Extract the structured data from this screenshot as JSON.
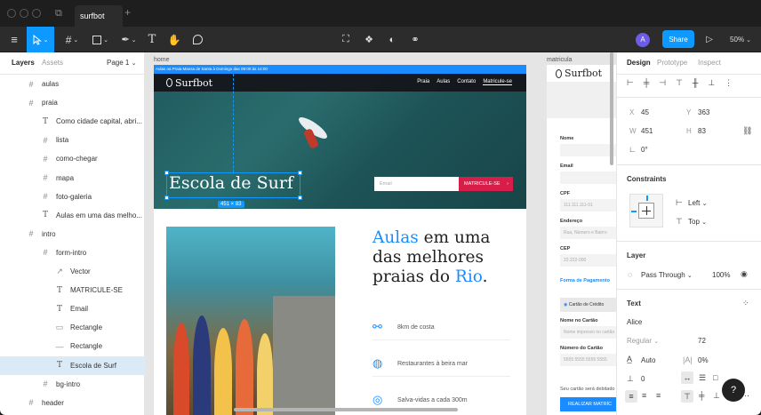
{
  "titlebar": {
    "tab_label": "surfbot",
    "new_tab": "+"
  },
  "toolbar": {
    "share_label": "Share",
    "zoom_label": "50%",
    "avatar_initial": "A"
  },
  "left": {
    "tab_layers": "Layers",
    "tab_assets": "Assets",
    "page_label": "Page 1",
    "layers": [
      {
        "label": "aulas",
        "type": "frame",
        "indent": 0
      },
      {
        "label": "praia",
        "type": "frame",
        "indent": 0
      },
      {
        "label": "Como cidade capital, abri...",
        "type": "text",
        "indent": 1
      },
      {
        "label": "lista",
        "type": "frame",
        "indent": 1
      },
      {
        "label": "como-chegar",
        "type": "frame",
        "indent": 1
      },
      {
        "label": "mapa",
        "type": "frame",
        "indent": 1
      },
      {
        "label": "foto-galeria",
        "type": "frame",
        "indent": 1
      },
      {
        "label": "Aulas em uma das melho...",
        "type": "text",
        "indent": 1
      },
      {
        "label": "intro",
        "type": "frame",
        "indent": 0
      },
      {
        "label": "form-intro",
        "type": "frame",
        "indent": 1
      },
      {
        "label": "Vector",
        "type": "vector",
        "indent": 2
      },
      {
        "label": "MATRICULE-SE",
        "type": "text",
        "indent": 2
      },
      {
        "label": "Email",
        "type": "text",
        "indent": 2
      },
      {
        "label": "Rectangle",
        "type": "rect",
        "indent": 2
      },
      {
        "label": "Rectangle",
        "type": "line",
        "indent": 2
      },
      {
        "label": "Escola de Surf",
        "type": "text",
        "indent": 2,
        "selected": true
      },
      {
        "label": "bg-intro",
        "type": "frame",
        "indent": 1
      },
      {
        "label": "header",
        "type": "frame",
        "indent": 0
      }
    ]
  },
  "canvas": {
    "frame_home_label": "home",
    "frame_matricula_label": "matricula",
    "topbar_text": "Aulas na Praia Mansa de Santa à Domingo das 09:00 às 14:00",
    "logo": "Surfbot",
    "nav": [
      "Praia",
      "Aulas",
      "Contato",
      "Matricule-se"
    ],
    "hero_title": "Escola de Surf",
    "dim_badge": "451 × 83",
    "email_placeholder": "Email",
    "cta": "MATRICULE-SE",
    "section_h1": "Aulas",
    "section_h2": " em uma das melhores praias do ",
    "section_h3": "Rio",
    "section_h4": ".",
    "features": [
      "8km de costa",
      "Restaurantes à beira mar",
      "Salva-vidas a cada 300m"
    ],
    "form": {
      "logo": "Surfbot",
      "name_label": "Nome",
      "email_label": "Email",
      "cpf_label": "CPF",
      "cpf_placeholder": "111.111.111-01",
      "address_label": "Endereço",
      "address_placeholder": "Rua, Número e Bairro",
      "cep_label": "CEP",
      "cep_placeholder": "22.222-000",
      "payment_label": "Forma de Pagamento",
      "card_option": "Cartão de Crédito",
      "card_name_label": "Nome no Cartão",
      "card_name_placeholder": "Nome impresso no cartão",
      "card_number_label": "Número do Cartão",
      "card_number_placeholder": "5555 5555 5555 5555",
      "debit_note": "Seu cartão será debitado",
      "submit": "REALIZAR MATRÍC"
    }
  },
  "right": {
    "tab_design": "Design",
    "tab_prototype": "Prototype",
    "tab_inspect": "Inspect",
    "x_label": "X",
    "x": "45",
    "y_label": "Y",
    "y": "363",
    "w_label": "W",
    "w": "451",
    "h_label": "H",
    "h": "83",
    "rot": "0°",
    "constraints_title": "Constraints",
    "c_h": "Left",
    "c_v": "Top",
    "layer_title": "Layer",
    "blend": "Pass Through",
    "opacity": "100%",
    "text_title": "Text",
    "font": "Alice",
    "weight": "Regular",
    "size": "72",
    "line_height": "Auto",
    "letter": "0%",
    "para": "0"
  },
  "help_label": "?"
}
